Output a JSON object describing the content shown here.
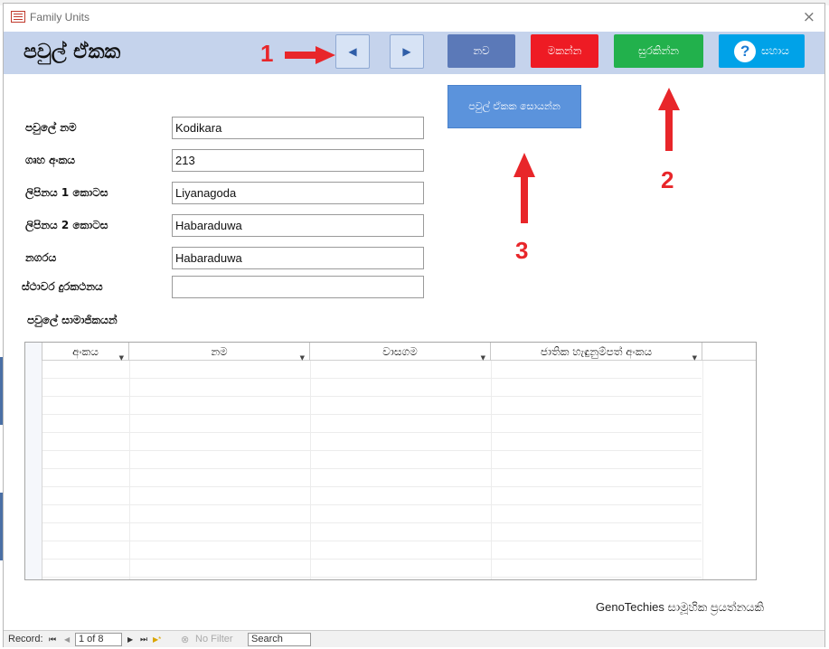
{
  "window": {
    "title": "Family Units",
    "close_glyph": "×"
  },
  "form": {
    "title": "පවුල් ඒකක"
  },
  "callouts": {
    "one": "1",
    "two": "2",
    "three": "3"
  },
  "toolbar": {
    "prev_glyph": "◀",
    "next_glyph": "▶",
    "new_label": "නව",
    "delete_label": "මකන්න",
    "save_label": "සුරකින්න",
    "help_glyph": "?",
    "help_label": "සහාය",
    "search_family_label": "පවුල් ඒකක සොයන්න",
    "colors": {
      "new": "#5b79b8",
      "delete": "#ee1b24",
      "save": "#22b14c",
      "help": "#00a2e8",
      "arrow": "#e8262a"
    }
  },
  "fields": [
    {
      "label": "පවුලේ නම",
      "value": "Kodikara"
    },
    {
      "label": "ගෘහ අංකය",
      "value": "213"
    },
    {
      "label": "ලිපිනය 1 කොටස",
      "value": "Liyanagoda"
    },
    {
      "label": "ලිපිනය 2 කොටස",
      "value": "Habaraduwa"
    },
    {
      "label": "නගරය",
      "value": "Habaraduwa"
    },
    {
      "label": "ස්ථාවර දුරකථනය",
      "value": ""
    }
  ],
  "members": {
    "label": "පවුලේ සාමාජිකයන්",
    "columns": [
      "අංකය",
      "නම",
      "වාසගම",
      "ජාතික හැඳුනුම්පත් අංකය"
    ],
    "dropdown_glyph": "▼"
  },
  "footer": {
    "credit": "GenoTechies සාමූහික ප්‍රයත්නයකි"
  },
  "statusbar": {
    "record_label": "Record:",
    "first": "⏮",
    "prev": "◀",
    "position": "1 of 8",
    "next": "▶",
    "last": "⏭",
    "new_record": "▶*",
    "filter_label": "No Filter",
    "search_label": "Search"
  }
}
